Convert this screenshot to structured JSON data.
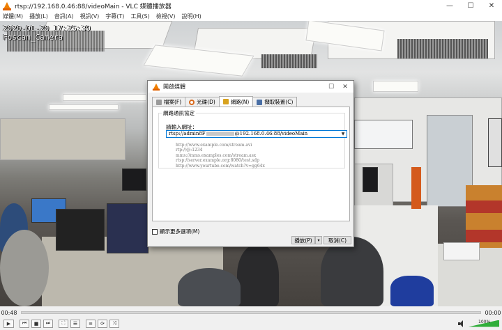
{
  "window": {
    "title": "rtsp://192.168.0.46:88/videoMain - VLC 媒體播放器",
    "minimize": "—",
    "maximize": "☐",
    "close": "✕"
  },
  "menu": [
    "媒體(M)",
    "播放(L)",
    "音訊(A)",
    "視訊(V)",
    "字幕(T)",
    "工具(S)",
    "檢視(V)",
    "說明(H)"
  ],
  "osd": {
    "timestamp": "2020-01-20 17:25:39",
    "camera": "Foscam_Camera"
  },
  "dialog": {
    "title": "開啟媒體",
    "close": "✕",
    "tabs": [
      {
        "label": "檔案(F)",
        "icon": "file-icon",
        "color": "#8a8a8a"
      },
      {
        "label": "光碟(D)",
        "icon": "disc-icon",
        "color": "#d86a1e"
      },
      {
        "label": "網路(N)",
        "icon": "network-icon",
        "color": "#d8a21e"
      },
      {
        "label": "擷取裝置(C)",
        "icon": "capture-icon",
        "color": "#4a6fa5"
      }
    ],
    "active_tab": "網路(N)",
    "group_title": "網路通訊協定",
    "url_label": "請輸入網址：",
    "url_prefix": "rtsp://admin8F",
    "url_suffix": "@192.168.0.46:88/videoMain",
    "examples": [
      "http://www.example.com/stream.avi",
      "rtp://@:1234",
      "mms://mms.examples.com/stream.asx",
      "rtsp://server.example.org:8080/test.sdp",
      "http://www.yourtube.com/watch?v=gg64x"
    ],
    "show_more": "顯示更多選項(M)",
    "play_button": "播放(P)",
    "cancel_button": "取消(C)"
  },
  "player": {
    "time_elapsed": "00:48",
    "time_total": "00:00",
    "volume_label": "100%",
    "volume": 1.0
  }
}
